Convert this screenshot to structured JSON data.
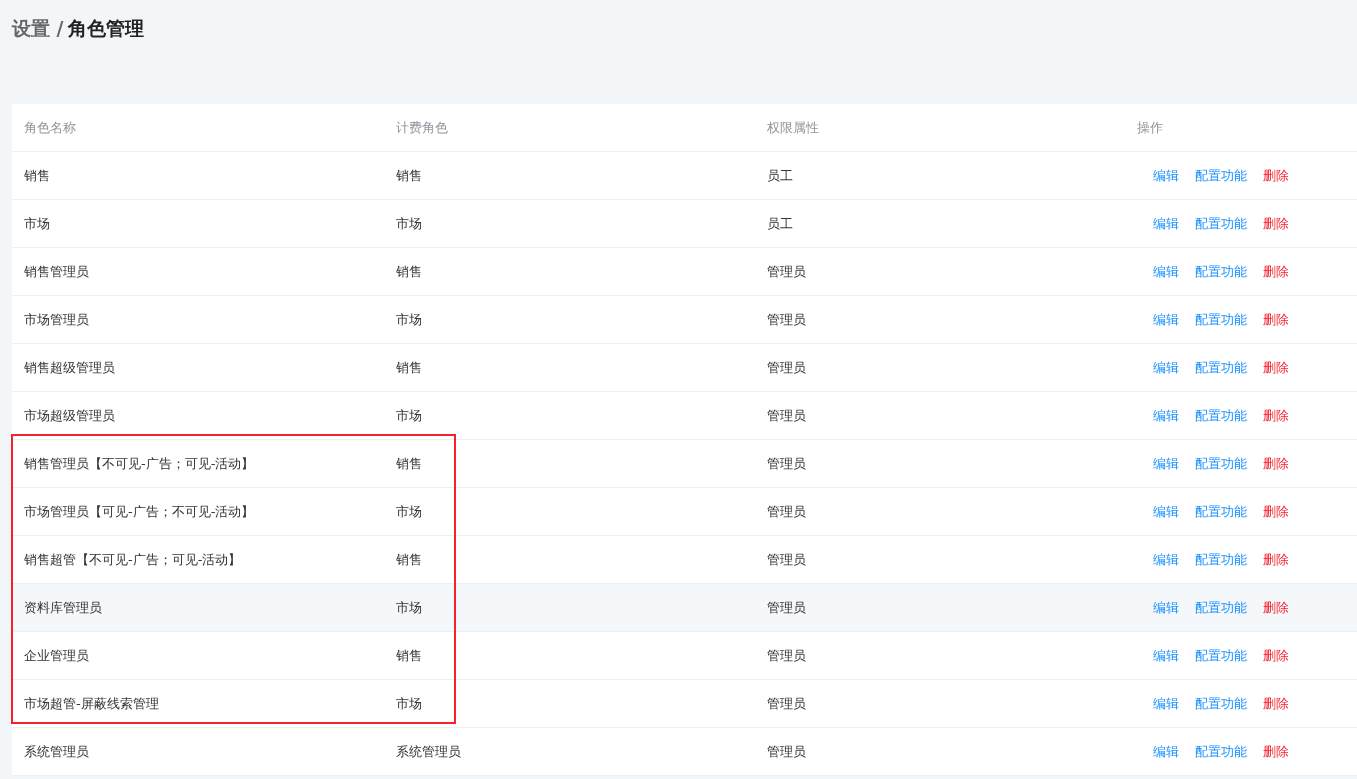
{
  "breadcrumb": {
    "parent": "设置 /",
    "current": "角色管理"
  },
  "table": {
    "columns": [
      "角色名称",
      "计费角色",
      "权限属性",
      "操作"
    ],
    "rows": [
      {
        "name": "销售",
        "billing": "销售",
        "permission": "员工",
        "highlighted": false,
        "outlined": false,
        "actions": [
          {
            "label": "编辑",
            "kind": "link"
          },
          {
            "label": "配置功能",
            "kind": "link"
          },
          {
            "label": "删除",
            "kind": "danger"
          }
        ]
      },
      {
        "name": "市场",
        "billing": "市场",
        "permission": "员工",
        "highlighted": false,
        "outlined": false,
        "actions": [
          {
            "label": "编辑",
            "kind": "link"
          },
          {
            "label": "配置功能",
            "kind": "link"
          },
          {
            "label": "删除",
            "kind": "danger"
          }
        ]
      },
      {
        "name": "销售管理员",
        "billing": "销售",
        "permission": "管理员",
        "highlighted": false,
        "outlined": false,
        "actions": [
          {
            "label": "编辑",
            "kind": "link"
          },
          {
            "label": "配置功能",
            "kind": "link"
          },
          {
            "label": "删除",
            "kind": "danger"
          }
        ]
      },
      {
        "name": "市场管理员",
        "billing": "市场",
        "permission": "管理员",
        "highlighted": false,
        "outlined": false,
        "actions": [
          {
            "label": "编辑",
            "kind": "link"
          },
          {
            "label": "配置功能",
            "kind": "link"
          },
          {
            "label": "删除",
            "kind": "danger"
          }
        ]
      },
      {
        "name": "销售超级管理员",
        "billing": "销售",
        "permission": "管理员",
        "highlighted": false,
        "outlined": false,
        "actions": [
          {
            "label": "编辑",
            "kind": "link"
          },
          {
            "label": "配置功能",
            "kind": "link"
          },
          {
            "label": "删除",
            "kind": "danger"
          }
        ]
      },
      {
        "name": "市场超级管理员",
        "billing": "市场",
        "permission": "管理员",
        "highlighted": false,
        "outlined": false,
        "actions": [
          {
            "label": "编辑",
            "kind": "link"
          },
          {
            "label": "配置功能",
            "kind": "link"
          },
          {
            "label": "删除",
            "kind": "danger"
          }
        ]
      },
      {
        "name": "销售管理员【不可见-广告；可见-活动】",
        "billing": "销售",
        "permission": "管理员",
        "highlighted": false,
        "outlined": true,
        "actions": [
          {
            "label": "编辑",
            "kind": "link"
          },
          {
            "label": "配置功能",
            "kind": "link"
          },
          {
            "label": "删除",
            "kind": "danger"
          }
        ]
      },
      {
        "name": "市场管理员【可见-广告；不可见-活动】",
        "billing": "市场",
        "permission": "管理员",
        "highlighted": false,
        "outlined": true,
        "actions": [
          {
            "label": "编辑",
            "kind": "link"
          },
          {
            "label": "配置功能",
            "kind": "link"
          },
          {
            "label": "删除",
            "kind": "danger"
          }
        ]
      },
      {
        "name": "销售超管【不可见-广告；可见-活动】",
        "billing": "销售",
        "permission": "管理员",
        "highlighted": false,
        "outlined": true,
        "actions": [
          {
            "label": "编辑",
            "kind": "link"
          },
          {
            "label": "配置功能",
            "kind": "link"
          },
          {
            "label": "删除",
            "kind": "danger"
          }
        ]
      },
      {
        "name": "资料库管理员",
        "billing": "市场",
        "permission": "管理员",
        "highlighted": true,
        "outlined": true,
        "actions": [
          {
            "label": "编辑",
            "kind": "link"
          },
          {
            "label": "配置功能",
            "kind": "link"
          },
          {
            "label": "删除",
            "kind": "danger"
          }
        ]
      },
      {
        "name": "企业管理员",
        "billing": "销售",
        "permission": "管理员",
        "highlighted": false,
        "outlined": true,
        "actions": [
          {
            "label": "编辑",
            "kind": "link"
          },
          {
            "label": "配置功能",
            "kind": "link"
          },
          {
            "label": "删除",
            "kind": "danger"
          }
        ]
      },
      {
        "name": "市场超管-屏蔽线索管理",
        "billing": "市场",
        "permission": "管理员",
        "highlighted": false,
        "outlined": true,
        "actions": [
          {
            "label": "编辑",
            "kind": "link"
          },
          {
            "label": "配置功能",
            "kind": "link"
          },
          {
            "label": "删除",
            "kind": "danger"
          }
        ]
      },
      {
        "name": "系统管理员",
        "billing": "系统管理员",
        "permission": "管理员",
        "highlighted": false,
        "outlined": false,
        "actions": [
          {
            "label": "编辑",
            "kind": "link"
          },
          {
            "label": "配置功能",
            "kind": "link"
          },
          {
            "label": "删除",
            "kind": "danger"
          }
        ]
      }
    ]
  }
}
